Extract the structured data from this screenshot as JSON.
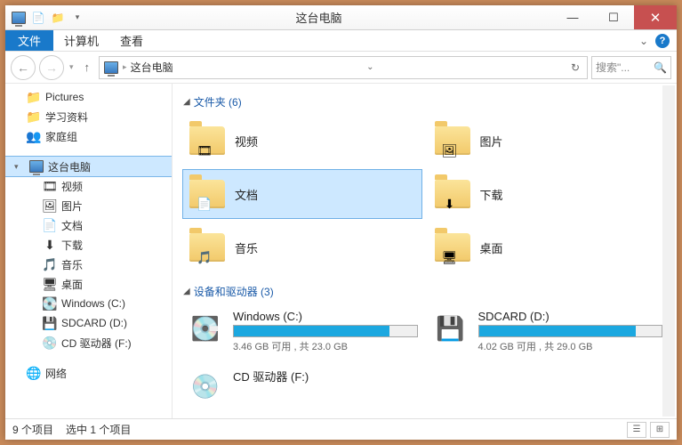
{
  "title": "这台电脑",
  "tabs": {
    "file": "文件",
    "computer": "计算机",
    "view": "查看"
  },
  "addr": {
    "location": "这台电脑"
  },
  "search": {
    "placeholder": "搜索\"..."
  },
  "sidebar": {
    "quick": [
      {
        "label": "Pictures",
        "icon": "📁"
      },
      {
        "label": "学习资料",
        "icon": "📁"
      },
      {
        "label": "家庭组",
        "icon": "👥"
      }
    ],
    "thispc": {
      "label": "这台电脑",
      "items": [
        {
          "label": "视频",
          "icon": "🎞"
        },
        {
          "label": "图片",
          "icon": "🖼"
        },
        {
          "label": "文档",
          "icon": "📄"
        },
        {
          "label": "下载",
          "icon": "⬇"
        },
        {
          "label": "音乐",
          "icon": "🎵"
        },
        {
          "label": "桌面",
          "icon": "🖥"
        },
        {
          "label": "Windows (C:)",
          "icon": "💽"
        },
        {
          "label": "SDCARD (D:)",
          "icon": "💾"
        },
        {
          "label": "CD 驱动器 (F:)",
          "icon": "💿"
        }
      ]
    },
    "network": {
      "label": "网络"
    }
  },
  "groups": {
    "folders": {
      "title": "文件夹 (6)",
      "items": [
        {
          "label": "视频",
          "badge": "🎞"
        },
        {
          "label": "图片",
          "badge": "🖼"
        },
        {
          "label": "文档",
          "badge": "📄",
          "selected": true
        },
        {
          "label": "下载",
          "badge": "⬇"
        },
        {
          "label": "音乐",
          "badge": "🎵"
        },
        {
          "label": "桌面",
          "badge": "🖥"
        }
      ]
    },
    "drives": {
      "title": "设备和驱动器 (3)",
      "items": [
        {
          "name": "Windows (C:)",
          "free": "3.46 GB 可用 , 共 23.0 GB",
          "fill": 85,
          "icon": "💽"
        },
        {
          "name": "SDCARD (D:)",
          "free": "4.02 GB 可用 , 共 29.0 GB",
          "fill": 86,
          "icon": "💾"
        },
        {
          "name": "CD 驱动器 (F:)",
          "free": "",
          "fill": 0,
          "icon": "💿",
          "nobar": true
        }
      ]
    }
  },
  "status": {
    "count": "9 个项目",
    "selected": "选中 1 个项目"
  }
}
